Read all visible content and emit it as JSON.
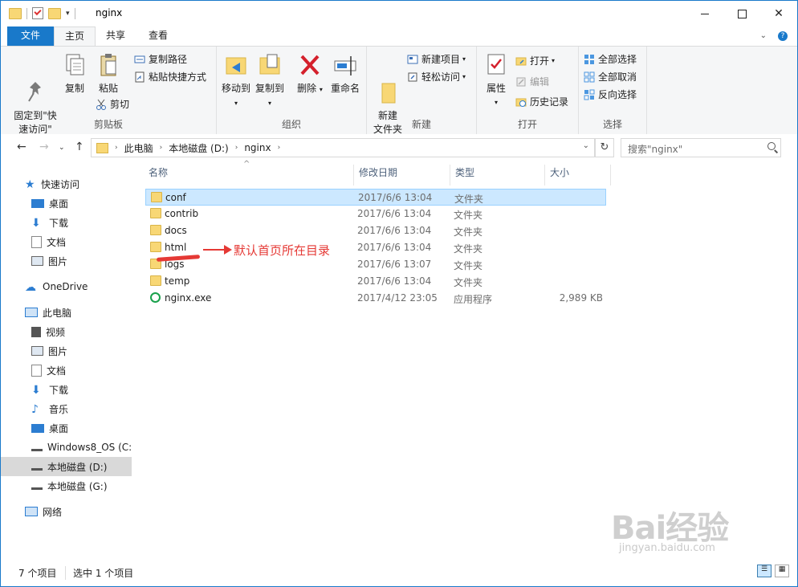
{
  "window": {
    "title": "nginx"
  },
  "tabs": {
    "file": "文件",
    "home": "主页",
    "share": "共享",
    "view": "查看"
  },
  "ribbon": {
    "clipboard": {
      "label": "剪贴板",
      "pin_quick_access": "固定到\"快\n速访问\"",
      "copy": "复制",
      "paste": "粘贴",
      "copy_path": "复制路径",
      "paste_shortcut": "粘贴快捷方式",
      "cut": "剪切"
    },
    "organize": {
      "label": "组织",
      "move_to": "移动到",
      "copy_to": "复制到",
      "delete": "删除",
      "rename": "重命名"
    },
    "new": {
      "label": "新建",
      "new_folder": "新建\n文件夹",
      "new_item": "新建项目",
      "easy_access": "轻松访问"
    },
    "open": {
      "label": "打开",
      "properties": "属性",
      "open": "打开",
      "edit": "编辑",
      "history": "历史记录"
    },
    "select": {
      "label": "选择",
      "select_all": "全部选择",
      "select_none": "全部取消",
      "invert": "反向选择"
    }
  },
  "address": {
    "crumbs": [
      "此电脑",
      "本地磁盘 (D:)",
      "nginx"
    ],
    "search_placeholder": "搜索\"nginx\""
  },
  "nav": {
    "quick_access": "快速访问",
    "qa_items": [
      "桌面",
      "下载",
      "文档",
      "图片"
    ],
    "onedrive": "OneDrive",
    "this_pc": "此电脑",
    "pc_items": [
      "视频",
      "图片",
      "文档",
      "下载",
      "音乐",
      "桌面"
    ],
    "drives": [
      "Windows8_OS (C:",
      "本地磁盘 (D:)",
      "本地磁盘 (G:)"
    ],
    "network": "网络"
  },
  "columns": {
    "name": "名称",
    "date": "修改日期",
    "type": "类型",
    "size": "大小"
  },
  "files": [
    {
      "name": "conf",
      "date": "2017/6/6 13:04",
      "type": "文件夹",
      "size": "",
      "selected": true
    },
    {
      "name": "contrib",
      "date": "2017/6/6 13:04",
      "type": "文件夹",
      "size": ""
    },
    {
      "name": "docs",
      "date": "2017/6/6 13:04",
      "type": "文件夹",
      "size": ""
    },
    {
      "name": "html",
      "date": "2017/6/6 13:04",
      "type": "文件夹",
      "size": ""
    },
    {
      "name": "logs",
      "date": "2017/6/6 13:07",
      "type": "文件夹",
      "size": ""
    },
    {
      "name": "temp",
      "date": "2017/6/6 13:04",
      "type": "文件夹",
      "size": ""
    },
    {
      "name": "nginx.exe",
      "date": "2017/4/12 23:05",
      "type": "应用程序",
      "size": "2,989 KB"
    }
  ],
  "annotation": {
    "text": "默认首页所在目录"
  },
  "status": {
    "count": "7 个项目",
    "selected": "选中 1 个项目"
  },
  "watermark": {
    "brand": "Bai经验",
    "url": "jingyan.baidu.com"
  },
  "colors": {
    "accent": "#1979ca",
    "selection": "#cce8ff",
    "annotation": "#e53935"
  }
}
